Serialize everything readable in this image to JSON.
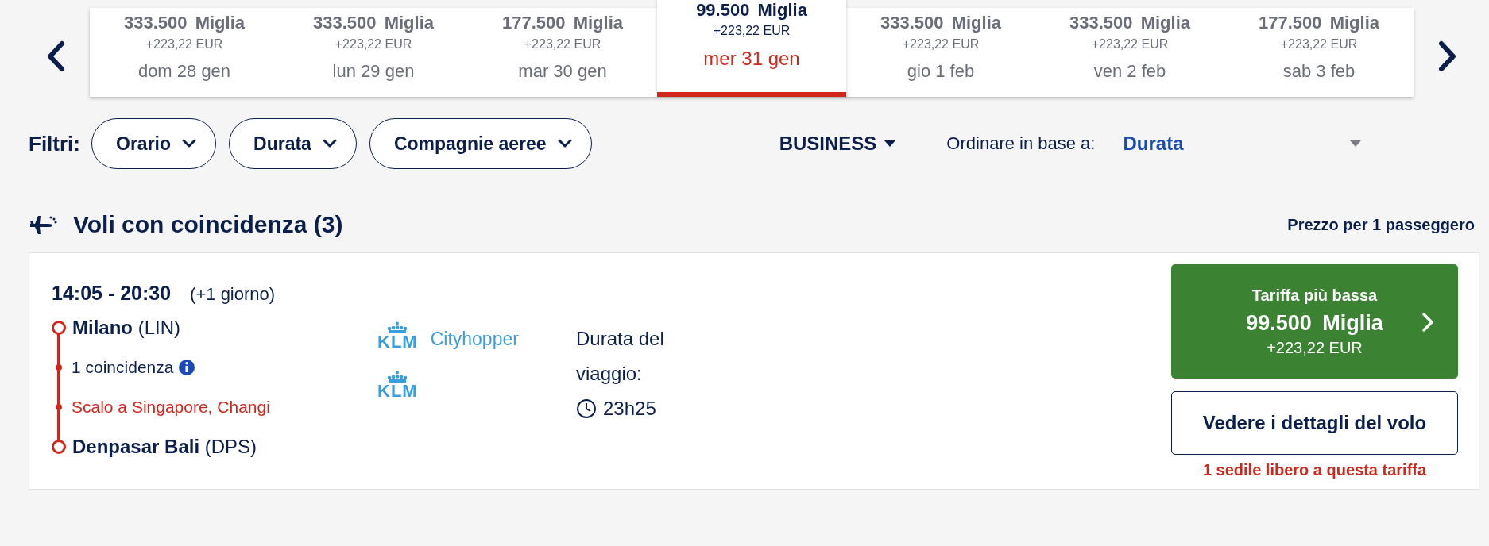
{
  "date_strip": {
    "days": [
      {
        "miles": "333.500 Miglia",
        "price": "+223,22 EUR",
        "date": "dom 28 gen",
        "selected": false
      },
      {
        "miles": "333.500 Miglia",
        "price": "+223,22 EUR",
        "date": "lun 29 gen",
        "selected": false
      },
      {
        "miles": "177.500 Miglia",
        "price": "+223,22 EUR",
        "date": "mar 30 gen",
        "selected": false
      },
      {
        "miles": "99.500 Miglia",
        "price": "+223,22 EUR",
        "date": "mer 31 gen",
        "selected": true
      },
      {
        "miles": "333.500 Miglia",
        "price": "+223,22 EUR",
        "date": "gio 1 feb",
        "selected": false
      },
      {
        "miles": "333.500 Miglia",
        "price": "+223,22 EUR",
        "date": "ven 2 feb",
        "selected": false
      },
      {
        "miles": "177.500 Miglia",
        "price": "+223,22 EUR",
        "date": "sab 3 feb",
        "selected": false
      }
    ]
  },
  "filters": {
    "label": "Filtri:",
    "pills": [
      "Orario",
      "Durata",
      "Compagnie aeree"
    ],
    "cabin": "BUSINESS",
    "sort_label": "Ordinare in base a:",
    "sort_value": "Durata"
  },
  "section": {
    "title": "Voli con coincidenza (3)",
    "price_note": "Prezzo per 1 passeggero"
  },
  "flight": {
    "times": "14:05 - 20:30",
    "day_offset": "(+1 giorno)",
    "stops": [
      {
        "kind": "endpoint",
        "city": "Milano",
        "code": "(LIN)"
      },
      {
        "kind": "info",
        "text": "1 coincidenza"
      },
      {
        "kind": "layover",
        "text": "Scalo a Singapore, Changi"
      },
      {
        "kind": "endpoint",
        "city": "Denpasar Bali",
        "code": "(DPS)"
      }
    ],
    "airlines": [
      {
        "logo": "KLM",
        "subbrand": "Cityhopper"
      },
      {
        "logo": "KLM"
      }
    ],
    "duration_label": "Durata del viaggio:",
    "duration": "23h25",
    "fare": {
      "label": "Tariffa più bassa",
      "miles": "99.500 Miglia",
      "price": "+223,22 EUR"
    },
    "details_button": "Vedere i dettagli del volo",
    "seats_note": "1 sedile libero a questa tariffa"
  }
}
